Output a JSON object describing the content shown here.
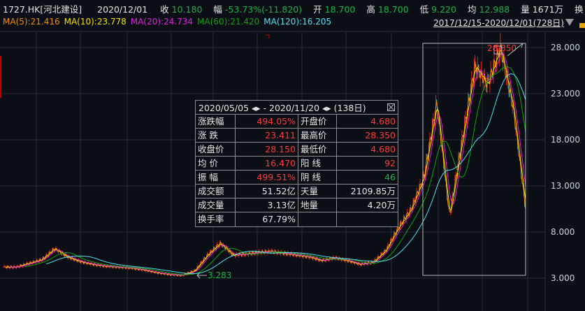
{
  "header": {
    "symbol": "1727.HK[河北建设]",
    "date": "2020/12/01",
    "items": [
      {
        "label": "收",
        "value": "10.180",
        "color": "g"
      },
      {
        "label": "幅",
        "value": "-53.73%(-11.820)",
        "color": "g"
      },
      {
        "label": "开",
        "value": "18.700",
        "color": "g"
      },
      {
        "label": "高",
        "value": "18.700",
        "color": "g"
      },
      {
        "label": "低",
        "value": "9.220",
        "color": "g"
      },
      {
        "label": "均",
        "value": "12.988",
        "color": "g"
      },
      {
        "label": "量",
        "value": "1671万",
        "color": "w"
      },
      {
        "label": "换",
        "value": "3.62%",
        "color": "w"
      }
    ]
  },
  "ma": [
    {
      "text": "MA(5):21.416",
      "color": "#f08c00"
    },
    {
      "text": "MA(10):23.778",
      "color": "#f0e000"
    },
    {
      "text": "MA(20):24.734",
      "color": "#e020e0"
    },
    {
      "text": "MA(60):21.420",
      "color": "#10a010"
    },
    {
      "text": "MA(120):16.205",
      "color": "#50e0f0"
    }
  ],
  "range_label": "2017/12/15-2020/12/01(728日)",
  "panel": {
    "title": "2020/05/05 ◂▸ - 2020/11/20 ◂▸  (138日)",
    "rows": [
      [
        {
          "t": "涨跌幅"
        },
        {
          "t": "494.05%",
          "c": "r"
        },
        {
          "t": "开盘价"
        },
        {
          "t": "4.680",
          "c": "r"
        }
      ],
      [
        {
          "t": "涨  跌"
        },
        {
          "t": "23.411",
          "c": "r"
        },
        {
          "t": "最高价"
        },
        {
          "t": "28.350",
          "c": "r"
        }
      ],
      [
        {
          "t": "收盘价"
        },
        {
          "t": "28.150",
          "c": "r"
        },
        {
          "t": "最低价"
        },
        {
          "t": "4.680",
          "c": "r"
        }
      ],
      [
        {
          "t": "均  价"
        },
        {
          "t": "16.470",
          "c": "r"
        },
        {
          "t": "阳  线"
        },
        {
          "t": "92",
          "c": "r"
        }
      ],
      [
        {
          "t": "振  幅"
        },
        {
          "t": "499.51%",
          "c": "r"
        },
        {
          "t": "阴  线"
        },
        {
          "t": "46",
          "c": "g"
        }
      ],
      [
        {
          "t": "成交额"
        },
        {
          "t": "51.52亿",
          "c": "w"
        },
        {
          "t": "天量"
        },
        {
          "t": "2109.85万",
          "c": "w"
        }
      ],
      [
        {
          "t": "成交量"
        },
        {
          "t": "3.13亿",
          "c": "w"
        },
        {
          "t": "地量"
        },
        {
          "t": "4.20万",
          "c": "w"
        }
      ],
      [
        {
          "t": "换手率"
        },
        {
          "t": "67.79%",
          "c": "w"
        },
        {
          "t": ""
        },
        {
          "t": ""
        }
      ]
    ]
  },
  "chart_data": {
    "type": "line",
    "y_ticks": [
      "28.000",
      "23.000",
      "18.000",
      "13.000",
      "8.000",
      "3.000"
    ],
    "ylim": [
      2.5,
      29.5
    ],
    "grid": true,
    "close_approx": [
      4.2,
      4.2,
      4.6,
      5.0,
      6.2,
      5.3,
      4.8,
      4.5,
      4.3,
      4.2,
      4.1,
      3.9,
      3.6,
      3.4,
      3.3,
      3.8,
      5.5,
      6.8,
      5.5,
      5.6,
      5.8,
      5.9,
      5.7,
      5.5,
      5.3,
      4.9,
      5.2,
      4.9,
      4.5,
      4.7,
      6.0,
      8.5,
      10.5,
      14.0,
      22.0,
      9.7,
      18.0,
      26.0,
      24.0,
      28.0,
      21.5,
      10.2
    ],
    "high_label": "28.350",
    "low_label": "3.283"
  }
}
